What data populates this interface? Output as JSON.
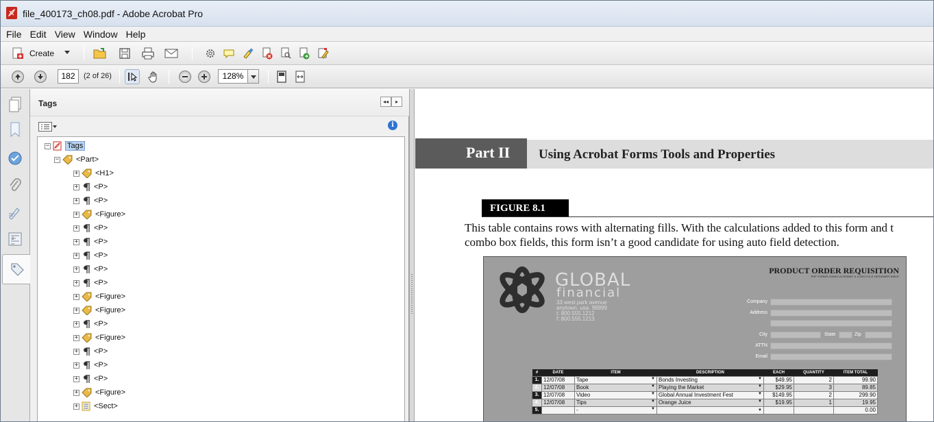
{
  "window": {
    "title": "file_400173_ch08.pdf - Adobe Acrobat Pro",
    "app_icon": "acrobat-pdf-icon"
  },
  "menu": [
    "File",
    "Edit",
    "View",
    "Window",
    "Help"
  ],
  "toolbar": {
    "create_label": "Create",
    "page_number": "182",
    "page_of": "(2 of 26)",
    "zoom": "128%"
  },
  "panel": {
    "title": "Tags",
    "collapse_left": "◂◂",
    "collapse_right": "▸",
    "info_icon_letter": "i",
    "tree": [
      {
        "label": "Tags",
        "icon": "pdf-icon",
        "toggle": "−",
        "level": 0,
        "selected": true
      },
      {
        "label": "<Part>",
        "icon": "tag-icon",
        "toggle": "−",
        "level": 1
      },
      {
        "label": "<H1>",
        "icon": "tag-icon",
        "toggle": "+",
        "level": 2
      },
      {
        "label": "<P>",
        "icon": "paragraph-icon",
        "toggle": "+",
        "level": 2
      },
      {
        "label": "<P>",
        "icon": "paragraph-icon",
        "toggle": "+",
        "level": 2
      },
      {
        "label": "<Figure>",
        "icon": "tag-icon",
        "toggle": "+",
        "level": 2
      },
      {
        "label": "<P>",
        "icon": "paragraph-icon",
        "toggle": "+",
        "level": 2
      },
      {
        "label": "<P>",
        "icon": "paragraph-icon",
        "toggle": "+",
        "level": 2
      },
      {
        "label": "<P>",
        "icon": "paragraph-icon",
        "toggle": "+",
        "level": 2
      },
      {
        "label": "<P>",
        "icon": "paragraph-icon",
        "toggle": "+",
        "level": 2
      },
      {
        "label": "<P>",
        "icon": "paragraph-icon",
        "toggle": "+",
        "level": 2
      },
      {
        "label": "<Figure>",
        "icon": "tag-icon",
        "toggle": "+",
        "level": 2
      },
      {
        "label": "<Figure>",
        "icon": "tag-icon",
        "toggle": "+",
        "level": 2
      },
      {
        "label": "<P>",
        "icon": "paragraph-icon",
        "toggle": "+",
        "level": 2
      },
      {
        "label": "<Figure>",
        "icon": "tag-icon",
        "toggle": "+",
        "level": 2
      },
      {
        "label": "<P>",
        "icon": "paragraph-icon",
        "toggle": "+",
        "level": 2
      },
      {
        "label": "<P>",
        "icon": "paragraph-icon",
        "toggle": "+",
        "level": 2
      },
      {
        "label": "<P>",
        "icon": "paragraph-icon",
        "toggle": "+",
        "level": 2
      },
      {
        "label": "<Figure>",
        "icon": "tag-icon",
        "toggle": "+",
        "level": 2
      },
      {
        "label": "<Sect>",
        "icon": "section-icon",
        "toggle": "+",
        "level": 2
      }
    ]
  },
  "document": {
    "part_label": "Part II",
    "part_title": "Using Acrobat Forms Tools and Properties",
    "figure_label": "FIGURE 8.1",
    "caption_line1": "This table contains rows with alternating fills. With the calculations added to this form and t",
    "caption_line2": "combo box fields, this form isn’t a good candidate for using auto field detection.",
    "form": {
      "company_name": "GLOBAL",
      "company_sub": "financial",
      "address_lines": [
        "33 west park avenue",
        "anytown, usa. 99999",
        "t: 800.555.1212",
        "f: 800.555.1213"
      ],
      "title": "PRODUCT ORDER REQUISITION",
      "subtitle": "PDF FORMS  USING ACROBAT & LIVECYCLE DESIGNER BIBLE",
      "labels": {
        "company": "Company",
        "address": "Address",
        "city": "City",
        "state": "State",
        "zip": "Zip",
        "attn": "ATTN",
        "email": "Email"
      },
      "table": {
        "headers": [
          "#",
          "DATE",
          "ITEM",
          "DESCRIPTION",
          "EACH",
          "QUANTITY",
          "ITEM TOTAL"
        ],
        "rows": [
          [
            "1.",
            "12/07/08",
            "Tape",
            "Bonds Investing",
            "$49.95",
            "2",
            "99.90"
          ],
          [
            "2.",
            "12/07/08",
            "Book",
            "Playing the Market",
            "$29.95",
            "3",
            "89.85"
          ],
          [
            "3.",
            "12/07/08",
            "Video",
            "Global Annual Investment Fest",
            "$149.95",
            "2",
            "299.90"
          ],
          [
            "4.",
            "12/07/08",
            "Tips",
            "Orange Juice",
            "$19.95",
            "1",
            "19.95"
          ],
          [
            "5.",
            "",
            "-",
            "",
            "",
            "",
            "0.00"
          ]
        ]
      }
    }
  }
}
